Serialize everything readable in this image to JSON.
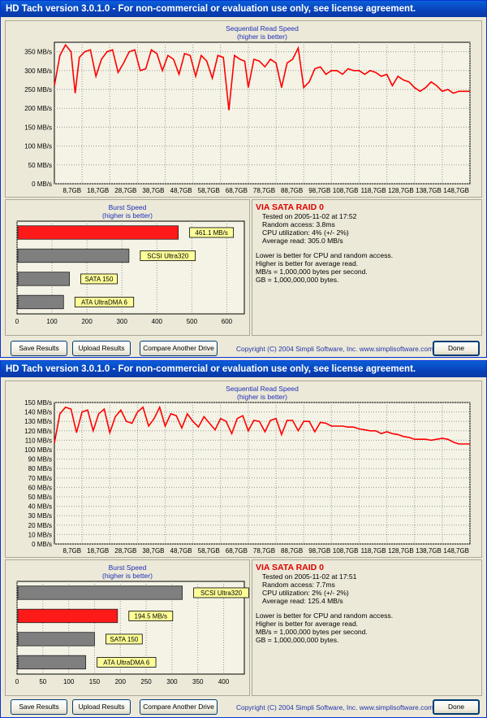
{
  "windows": [
    {
      "title": "HD Tach version 3.0.1.0  - For non-commercial or evaluation use only, see license agreement.",
      "seq_chart": {
        "title": "Sequential Read Speed",
        "subtitle": "(higher is better)",
        "yticks": [
          "350 MB/s",
          "300 MB/s",
          "250 MB/s",
          "200 MB/s",
          "150 MB/s",
          "100 MB/s",
          "50 MB/s",
          "0 MB/s"
        ],
        "xticks": [
          "8,7GB",
          "18,7GB",
          "28,7GB",
          "38,7GB",
          "48,7GB",
          "58,7GB",
          "68,7GB",
          "78,7GB",
          "88,7GB",
          "98,7GB",
          "108,7GB",
          "118,7GB",
          "128,7GB",
          "138,7GB",
          "148,7GB"
        ]
      },
      "burst_chart": {
        "title": "Burst Speed",
        "subtitle": "(higher is better)",
        "xticks": [
          "0",
          "100",
          "200",
          "300",
          "400",
          "500",
          "600"
        ],
        "bars": [
          {
            "label": "461.1 MB/s",
            "value": 461.1,
            "highlight": true
          },
          {
            "label": "SCSI Ultra320",
            "value": 320,
            "highlight": false
          },
          {
            "label": "SATA 150",
            "value": 150,
            "highlight": false
          },
          {
            "label": "ATA UltraDMA 6",
            "value": 133,
            "highlight": false
          }
        ]
      },
      "info": {
        "heading": "VIA SATA RAID 0",
        "tested": "Tested on 2005-11-02 at 17:52",
        "random": "Random access: 3.8ms",
        "cpu": "CPU utilization: 4% (+/- 2%)",
        "avg": "Average read: 305.0 MB/s",
        "note1": "Lower is better for CPU and random access.",
        "note2": "Higher is better for average read.",
        "note3": "MB/s = 1,000,000 bytes per second.",
        "note4": "GB = 1,000,000,000 bytes."
      },
      "buttons": {
        "save": "Save Results",
        "upload": "Upload Results",
        "compare": "Compare Another Drive",
        "done": "Done"
      },
      "copyright": "Copyright (C) 2004 Simpli Software, Inc. www.simplisoftware.com"
    },
    {
      "title": "HD Tach version 3.0.1.0  - For non-commercial or evaluation use only, see license agreement.",
      "seq_chart": {
        "title": "Sequential Read Speed",
        "subtitle": "(higher is better)",
        "yticks": [
          "150 MB/s",
          "140 MB/s",
          "130 MB/s",
          "120 MB/s",
          "110 MB/s",
          "100 MB/s",
          "90 MB/s",
          "80 MB/s",
          "70 MB/s",
          "60 MB/s",
          "50 MB/s",
          "40 MB/s",
          "30 MB/s",
          "20 MB/s",
          "10 MB/s",
          "0 MB/s"
        ],
        "xticks": [
          "8,7GB",
          "18,7GB",
          "28,7GB",
          "38,7GB",
          "48,7GB",
          "58,7GB",
          "68,7GB",
          "78,7GB",
          "88,7GB",
          "98,7GB",
          "108,7GB",
          "118,7GB",
          "128,7GB",
          "138,7GB",
          "148,7GB"
        ]
      },
      "burst_chart": {
        "title": "Burst Speed",
        "subtitle": "(higher is better)",
        "xticks": [
          "0",
          "50",
          "100",
          "150",
          "200",
          "250",
          "300",
          "350",
          "400"
        ],
        "bars": [
          {
            "label": "SCSI Ultra320",
            "value": 320,
            "highlight": false
          },
          {
            "label": "194.5 MB/s",
            "value": 194.5,
            "highlight": true
          },
          {
            "label": "SATA 150",
            "value": 150,
            "highlight": false
          },
          {
            "label": "ATA UltraDMA 6",
            "value": 133,
            "highlight": false
          }
        ]
      },
      "info": {
        "heading": "VIA SATA RAID 0",
        "tested": "Tested on 2005-11-02 at 17:51",
        "random": "Random access: 7.7ms",
        "cpu": "CPU utilization: 2% (+/- 2%)",
        "avg": "Average read: 125.4 MB/s",
        "note1": "Lower is better for CPU and random access.",
        "note2": "Higher is better for average read.",
        "note3": "MB/s = 1,000,000 bytes per second.",
        "note4": "GB = 1,000,000,000 bytes."
      },
      "buttons": {
        "save": "Save Results",
        "upload": "Upload Results",
        "compare": "Compare Another Drive",
        "done": "Done"
      },
      "copyright": "Copyright (C) 2004 Simpli Software, Inc. www.simplisoftware.com"
    }
  ],
  "chart_data": [
    {
      "type": "line",
      "title": "Sequential Read Speed",
      "subtitle": "(higher is better)",
      "ylim": [
        0,
        375
      ],
      "xlim": [
        0,
        150
      ],
      "series": [
        {
          "color": "#ff0000",
          "x": [
            0,
            2,
            4,
            6,
            7.5,
            9,
            11,
            13,
            15,
            17,
            19,
            21,
            23,
            25,
            27,
            29,
            31,
            33,
            35,
            37,
            39,
            41,
            43,
            45,
            47,
            49,
            51,
            53,
            55,
            57,
            59,
            61,
            63,
            65,
            67,
            68.7,
            70,
            72,
            74,
            76,
            78,
            80,
            82,
            84,
            86,
            88,
            90,
            92,
            94,
            96,
            98,
            100,
            102,
            104,
            106,
            108,
            110,
            112,
            114,
            116,
            118,
            120,
            122,
            124,
            126,
            128,
            130,
            132,
            134,
            136,
            138,
            140,
            142,
            144,
            146,
            148,
            150
          ],
          "y": [
            260,
            340,
            368,
            350,
            240,
            335,
            350,
            355,
            285,
            330,
            350,
            355,
            295,
            320,
            350,
            355,
            300,
            305,
            355,
            345,
            300,
            340,
            330,
            290,
            345,
            340,
            285,
            340,
            325,
            280,
            340,
            335,
            195,
            340,
            330,
            325,
            255,
            330,
            325,
            310,
            330,
            320,
            255,
            320,
            330,
            360,
            255,
            270,
            305,
            310,
            290,
            300,
            300,
            290,
            305,
            300,
            300,
            290,
            300,
            295,
            285,
            290,
            260,
            285,
            275,
            270,
            255,
            245,
            255,
            270,
            260,
            245,
            250,
            240,
            245,
            245,
            245
          ]
        }
      ],
      "yticks": [
        350,
        300,
        250,
        200,
        150,
        100,
        50,
        0
      ],
      "xticks": [
        "8,7GB",
        "18,7GB",
        "28,7GB",
        "38,7GB",
        "48,7GB",
        "58,7GB",
        "68,7GB",
        "78,7GB",
        "88,7GB",
        "98,7GB",
        "108,7GB",
        "118,7GB",
        "128,7GB",
        "138,7GB",
        "148,7GB"
      ],
      "grid": true
    },
    {
      "type": "bar",
      "title": "Burst Speed",
      "subtitle": "(higher is better)",
      "categories": [
        "461.1 MB/s",
        "SCSI Ultra320",
        "SATA 150",
        "ATA UltraDMA 6"
      ],
      "values": [
        461.1,
        320,
        150,
        133
      ],
      "xlim": [
        0,
        650
      ],
      "grid": true
    },
    {
      "type": "line",
      "title": "Sequential Read Speed",
      "subtitle": "(higher is better)",
      "ylim": [
        0,
        150
      ],
      "xlim": [
        0,
        150
      ],
      "series": [
        {
          "color": "#ff0000",
          "x": [
            0,
            2,
            4,
            6,
            8,
            10,
            12,
            14,
            16,
            18,
            20,
            22,
            24,
            26,
            28,
            30,
            32,
            34,
            36,
            38,
            40,
            42,
            44,
            46,
            48,
            50,
            52,
            54,
            56,
            58,
            60,
            62,
            64,
            66,
            68,
            70,
            72,
            74,
            76,
            78,
            80,
            82,
            84,
            86,
            88,
            90,
            92,
            94,
            96,
            98,
            100,
            102,
            104,
            106,
            108,
            110,
            112,
            114,
            116,
            118,
            120,
            122,
            124,
            126,
            128,
            130,
            132,
            134,
            136,
            138,
            140,
            142,
            144,
            146,
            148,
            150
          ],
          "y": [
            107,
            138,
            145,
            143,
            118,
            140,
            142,
            120,
            138,
            143,
            118,
            135,
            142,
            130,
            128,
            140,
            145,
            125,
            133,
            145,
            125,
            138,
            136,
            123,
            138,
            130,
            124,
            135,
            128,
            121,
            133,
            130,
            117,
            133,
            136,
            120,
            131,
            130,
            119,
            131,
            133,
            116,
            131,
            131,
            120,
            130,
            130,
            119,
            129,
            128,
            125,
            125,
            125,
            124,
            124,
            122,
            121,
            120,
            120,
            117,
            119,
            117,
            116,
            114,
            113,
            111,
            111,
            111,
            110,
            111,
            112,
            111,
            108,
            106,
            106,
            106
          ]
        }
      ],
      "yticks": [
        150,
        140,
        130,
        120,
        110,
        100,
        90,
        80,
        70,
        60,
        50,
        40,
        30,
        20,
        10,
        0
      ],
      "xticks": [
        "8,7GB",
        "18,7GB",
        "28,7GB",
        "38,7GB",
        "48,7GB",
        "58,7GB",
        "68,7GB",
        "78,7GB",
        "88,7GB",
        "98,7GB",
        "108,7GB",
        "118,7GB",
        "128,7GB",
        "138,7GB",
        "148,7GB"
      ],
      "grid": true
    },
    {
      "type": "bar",
      "title": "Burst Speed",
      "subtitle": "(higher is better)",
      "categories": [
        "SCSI Ultra320",
        "194.5 MB/s",
        "SATA 150",
        "ATA UltraDMA 6"
      ],
      "values": [
        320,
        194.5,
        150,
        133
      ],
      "xlim": [
        0,
        440
      ],
      "grid": true
    }
  ]
}
